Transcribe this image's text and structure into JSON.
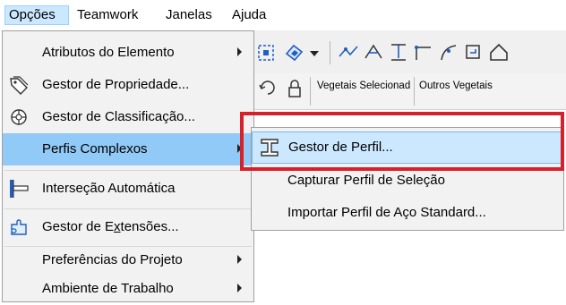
{
  "menubar": {
    "items": [
      {
        "label": "Opções",
        "active": true
      },
      {
        "label": "Teamwork",
        "active": false
      },
      {
        "label": "Janelas",
        "active": false
      },
      {
        "label": "Ajuda",
        "active": false
      }
    ]
  },
  "ribbon": {
    "label_vegetais": "Vegetais Selecionad",
    "label_outros": "Outros Vegetais"
  },
  "menu": {
    "items": [
      {
        "label": "Atributos do Elemento",
        "icon": "none",
        "submenu": true
      },
      {
        "label": "Gestor de Propriedade...",
        "icon": "tags-icon",
        "submenu": false
      },
      {
        "label": "Gestor de Classificação...",
        "icon": "classification-icon",
        "submenu": false
      },
      {
        "label": "Perfis Complexos",
        "icon": "none",
        "submenu": true,
        "highlighted": true
      },
      {
        "label": "Interseção Automática",
        "icon": "intersection-icon",
        "submenu": false
      },
      {
        "label_pre": "Gestor de E",
        "label_ul": "x",
        "label_post": "tensões...",
        "icon": "extensions-icon",
        "submenu": false
      },
      {
        "label": "Preferências do Projeto",
        "icon": "none",
        "submenu": true
      },
      {
        "label": "Ambiente de Trabalho",
        "icon": "none",
        "submenu": true
      }
    ]
  },
  "submenu": {
    "items": [
      {
        "label": "Gestor de Perfil...",
        "icon": "i-beam-icon",
        "highlighted": true
      },
      {
        "label": "Capturar Perfil de Seleção"
      },
      {
        "label": "Importar Perfil de Aço Standard..."
      }
    ]
  },
  "colors": {
    "highlight_main": "#91c9f7",
    "highlight_sub": "#cce8ff",
    "annotation": "#d8202a"
  }
}
